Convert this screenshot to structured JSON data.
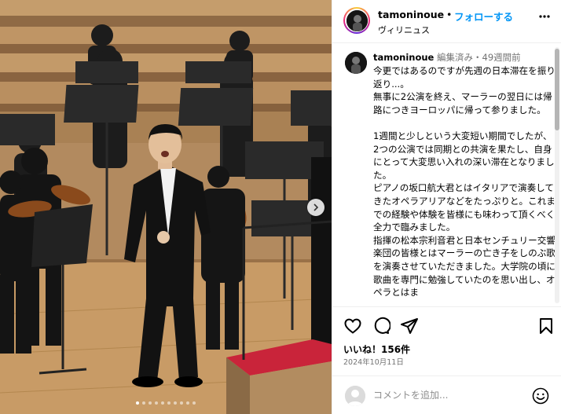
{
  "header": {
    "username": "tamoninoue",
    "separator": "•",
    "follow_label": "フォローする",
    "location": "ヴィリニュス",
    "more_label": "•••"
  },
  "caption": {
    "username": "tamoninoue",
    "meta": "編集済み・49週間前",
    "text": "今更ではあるのですが先週の日本滞在を振り返り...。\n無事に2公演を終え、マーラーの翌日には帰路につきヨーロッパに帰って参りました。\n\n1週間と少しという大変短い期間でしたが、2つの公演では同期との共演を果たし、自身にとって大変思い入れの深い滞在となりました。\nピアノの坂口航大君とはイタリアで演奏してきたオペラアリアなどをたっぷりと。これまでの経験や体験を皆様にも味わって頂くべく全力で臨みました。\n指揮の松本宗利音君と日本センチュリー交響楽団の皆様とはマーラーの亡き子をしのぶ歌を演奏させていただきました。大学院の頃に歌曲を専門に勉強していたのを思い出し、オペラとはま"
  },
  "actions": {
    "icons": [
      "heart-icon",
      "comment-icon",
      "share-icon",
      "bookmark-icon"
    ],
    "likes_label": "いいね！156件",
    "date": "2024年10月11日"
  },
  "comment": {
    "placeholder": "コメントを追加..."
  },
  "photo": {
    "dots_total": 10,
    "dots_active": 1
  },
  "colors": {
    "accent": "#0095f6",
    "muted": "#737373",
    "border": "#efefef",
    "stage_wood": "#a8845e"
  }
}
